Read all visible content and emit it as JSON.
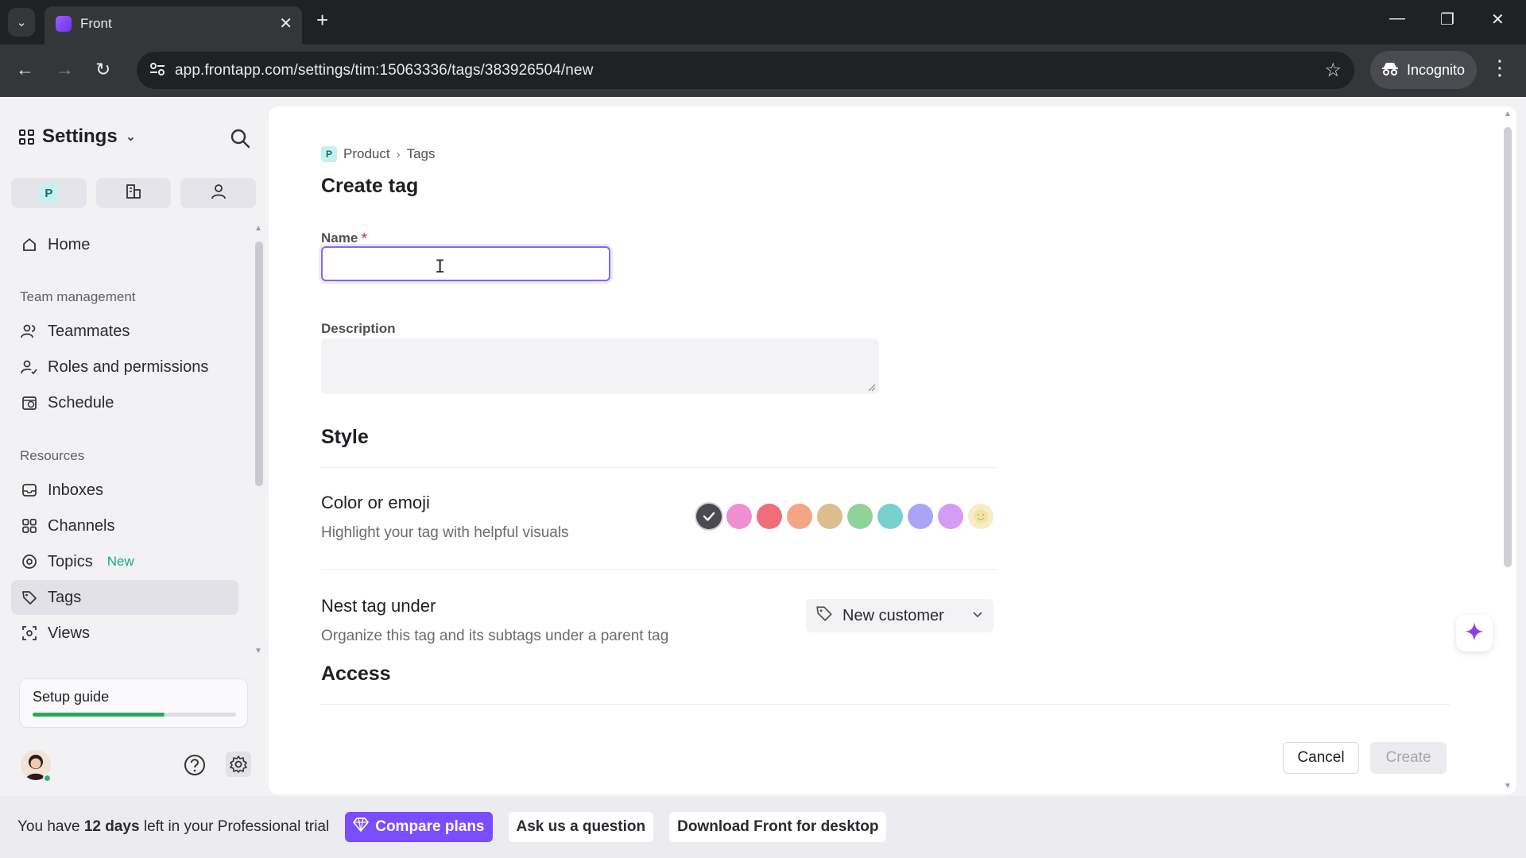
{
  "browser": {
    "tab_title": "Front",
    "url": "app.frontapp.com/settings/tim:15063336/tags/383926504/new",
    "incognito_label": "Incognito"
  },
  "sidebar": {
    "title": "Settings",
    "scope_badge": "P",
    "home": "Home",
    "team_section": "Team management",
    "team_items": [
      "Teammates",
      "Roles and permissions",
      "Schedule"
    ],
    "resources_section": "Resources",
    "resource_items": [
      "Inboxes",
      "Channels",
      "Topics",
      "Tags",
      "Views"
    ],
    "topics_badge": "New",
    "active_item": "Tags",
    "setup_guide": {
      "label": "Setup guide",
      "progress": 0.65
    }
  },
  "main": {
    "breadcrumb": {
      "badge": "P",
      "parent": "Product",
      "current": "Tags"
    },
    "title": "Create tag",
    "name_label": "Name",
    "required_mark": "*",
    "name_value": "",
    "description_label": "Description",
    "description_value": "",
    "style_heading": "Style",
    "color_title": "Color or emoji",
    "color_sub": "Highlight your tag with helpful visuals",
    "colors": [
      "#4a4a50",
      "#ee8fd0",
      "#ee6e79",
      "#f4a585",
      "#dbbd8e",
      "#8fd39a",
      "#79d1cf",
      "#a9a4f4",
      "#d49cf2"
    ],
    "selected_color_index": 0,
    "nest_title": "Nest tag under",
    "nest_sub": "Organize this tag and its subtags under a parent tag",
    "nest_value": "New customer",
    "access_heading": "Access",
    "cancel_label": "Cancel",
    "create_label": "Create"
  },
  "trial": {
    "text_before": "You have ",
    "days": "12 days",
    "text_after": " left in your Professional trial",
    "compare_label": "Compare plans",
    "ask_label": "Ask us a question",
    "download_label": "Download Front for desktop"
  }
}
